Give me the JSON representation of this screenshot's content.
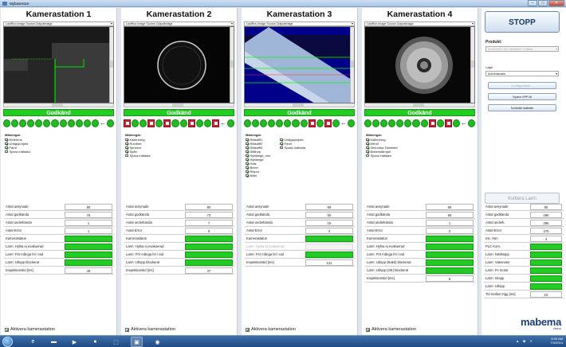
{
  "window": {
    "title": "Mybaserace"
  },
  "stations": [
    {
      "title": "Kamerastation 1",
      "source": "LastRun.Image Source.OutputImage",
      "status": "Godkänd",
      "history": [
        "ok",
        "ok",
        "ok",
        "ok",
        "ok",
        "ok",
        "ok",
        "ok",
        "ok",
        "ok",
        "ok",
        "ok"
      ],
      "meas_header": "Mätningar:",
      "measures_col1": [
        "Referens",
        "Urtagsprojekt",
        "Färre",
        "Spara mätdata"
      ],
      "measures_col1_checked": [
        true,
        true,
        true,
        false
      ],
      "measures_col2": [],
      "measures_col2_checked": [],
      "stats": [
        {
          "label": "Antal avsynade",
          "value": "80",
          "type": "num"
        },
        {
          "label": "Antal godkända",
          "value": "76",
          "type": "num"
        },
        {
          "label": "Antal underkända",
          "value": "1",
          "type": "num"
        },
        {
          "label": "Antal Error",
          "value": "1",
          "type": "num"
        },
        {
          "label": "Kamerastatus",
          "value": "",
          "type": "green"
        },
        {
          "label": "Larm: Hylsa ej evakuerad",
          "value": "",
          "type": "green"
        },
        {
          "label": "Larm: För många fel i rad",
          "value": "",
          "type": "green"
        },
        {
          "label": "Larm: Utlopp blockerat",
          "value": "",
          "type": "green"
        },
        {
          "label": "Inspektionstid [ms]",
          "value": "40",
          "type": "num"
        }
      ],
      "activate": "Aktivera kamerastation"
    },
    {
      "title": "Kamerastation 2",
      "source": "LastRun.Image Source.OutputImage",
      "status": "Godkänd",
      "history": [
        "bad",
        "ok",
        "ok",
        "bad",
        "ok",
        "bad",
        "ok",
        "ok",
        "bad",
        "ok",
        "ok",
        "bad"
      ],
      "meas_header": "Mätningar:",
      "measures_col1": [
        "Kalibrering",
        "Rundhet",
        "Sprickor",
        "Spån",
        "Spara mätdata"
      ],
      "measures_col1_checked": [
        true,
        true,
        true,
        true,
        false
      ],
      "measures_col2": [],
      "measures_col2_checked": [],
      "stats": [
        {
          "label": "Antal avsynade",
          "value": "80",
          "type": "num"
        },
        {
          "label": "Antal godkända",
          "value": "73",
          "type": "num"
        },
        {
          "label": "Antal underkända",
          "value": "7",
          "type": "num"
        },
        {
          "label": "Antal Error",
          "value": "0",
          "type": "num"
        },
        {
          "label": "Kamerastatus",
          "value": "",
          "type": "green"
        },
        {
          "label": "Larm: Hylsa ej evakuerad",
          "value": "",
          "type": "green"
        },
        {
          "label": "Larm: För många fel i rad",
          "value": "",
          "type": "green"
        },
        {
          "label": "Larm: Utlopp blockerat",
          "value": "",
          "type": "green"
        },
        {
          "label": "Inspektionstid [ms]",
          "value": "47",
          "type": "num"
        }
      ],
      "activate": "Aktivera kamerastation"
    },
    {
      "title": "Kamerastation 3",
      "source": "LastRun.Image Source.OutputImage",
      "status": "Godkänd",
      "history": [
        "ok",
        "ok",
        "ok",
        "ok",
        "ok",
        "ok",
        "ok",
        "ok",
        "bad",
        "ok",
        "bad",
        "ok"
      ],
      "meas_header": "Mätningar:",
      "measures_col1": [
        "Rätsdiff1",
        "Rätsdiff2",
        "Rätsdiff3",
        "Stålhop",
        "Hyttlängd_mm",
        "Hyttlängd",
        "Hals",
        "Bricer",
        "Rispor",
        "Bölle"
      ],
      "measures_col1_checked": [
        true,
        true,
        true,
        true,
        true,
        true,
        true,
        true,
        true,
        true
      ],
      "measures_col2": [
        "Urtagsprojekt",
        "Färre",
        "Spara mätdata"
      ],
      "measures_col2_checked": [
        true,
        true,
        false
      ],
      "stats": [
        {
          "label": "Antal avsynade",
          "value": "69",
          "type": "num"
        },
        {
          "label": "Antal godkända",
          "value": "50",
          "type": "num"
        },
        {
          "label": "Antal underkända",
          "value": "15",
          "type": "num"
        },
        {
          "label": "Antal Error",
          "value": "4",
          "type": "num"
        },
        {
          "label": "Kamerastatus",
          "value": "",
          "type": "green"
        },
        {
          "label": "Larm: Hylsa ej evakuerad",
          "value": "",
          "type": "disabled"
        },
        {
          "label": "Larm: För många fel i rad",
          "value": "",
          "type": "green"
        },
        {
          "label": "Inspektionstid [ms]",
          "value": "121",
          "type": "num"
        }
      ],
      "activate": "Aktivera kamerastation"
    },
    {
      "title": "Kamerastation 4",
      "source": "LastRun.Image Source.OutputImage",
      "status": "Godkänd",
      "history": [
        "ok",
        "ok",
        "ok",
        "ok",
        "ok",
        "ok",
        "ok",
        "ok",
        "bad",
        "ok",
        "bad",
        "ok"
      ],
      "meas_header": "Mätningar:",
      "measures_col1": [
        "Kalibrering",
        "Etthöl",
        "Sekundor Diameter",
        "Bottenstämpel",
        "Spara mätdata"
      ],
      "measures_col1_checked": [
        true,
        true,
        true,
        true,
        false
      ],
      "measures_col2": [],
      "measures_col2_checked": [],
      "stats": [
        {
          "label": "Antal avsynade",
          "value": "69",
          "type": "num"
        },
        {
          "label": "Antal godkända",
          "value": "66",
          "type": "num"
        },
        {
          "label": "Antal underkända",
          "value": "1",
          "type": "num"
        },
        {
          "label": "Antal Error",
          "value": "2",
          "type": "num"
        },
        {
          "label": "Kamerastatus",
          "value": "",
          "type": "green"
        },
        {
          "label": "Larm: Hylsa ej evakuerad",
          "value": "",
          "type": "green"
        },
        {
          "label": "Larm: För många fel i rad",
          "value": "",
          "type": "green"
        },
        {
          "label": "Larm: Utlopp (Bakd) blockerat",
          "value": "",
          "type": "green"
        },
        {
          "label": "Larm: Utlopp (OK) blockerat",
          "value": "",
          "type": "green"
        },
        {
          "label": "Inspektionstid [ms]",
          "value": "6",
          "type": "num"
        }
      ],
      "activate": "Aktivera kamerastation"
    }
  ],
  "side": {
    "stop_label": "STOPP",
    "product_label": "Produkt:",
    "product_value": "NOSSLER 300 WINMAG Tvättad",
    "login_label": "Login",
    "login_value": "Administratör",
    "buttons": [
      "Konfiguration...",
      "Spara VPP-fil",
      "Nollställ statistik"
    ],
    "buttons_disabled": [
      true,
      false,
      false
    ],
    "ack_label": "Kvittera Larm",
    "stats": [
      {
        "label": "Antal avsynade",
        "value": "80",
        "type": "num"
      },
      {
        "label": "Antal godkända",
        "value": "265",
        "type": "num"
      },
      {
        "label": "Antal underk.",
        "value": "265",
        "type": "num"
      },
      {
        "label": "Antal Error",
        "value": "270",
        "type": "num"
      },
      {
        "label": "Ink. Hon",
        "value": "4",
        "type": "num"
      },
      {
        "label": "PLC Kom.",
        "value": "",
        "type": "green"
      },
      {
        "label": "Larm: Nödstopp",
        "value": "",
        "type": "green"
      },
      {
        "label": "Larm: Vakenator",
        "value": "",
        "type": "green"
      },
      {
        "label": "Larm: Fe motor",
        "value": "",
        "type": "green"
      },
      {
        "label": "Larm: Inlopp",
        "value": "",
        "type": "green"
      },
      {
        "label": "Larm: Utlopp",
        "value": "",
        "type": "green"
      },
      {
        "label": "Tid mellan trigg [ms]",
        "value": "10",
        "type": "num"
      }
    ],
    "logo": "mabema",
    "logo_sub": "vision"
  },
  "taskbar": {
    "time": "8:35 AM",
    "date": "7/4/2014"
  },
  "colors": {
    "ok": "#22cc22",
    "bad": "#cc2233",
    "stop_text": "#1a3a6a",
    "logo": "#1c3e78"
  }
}
